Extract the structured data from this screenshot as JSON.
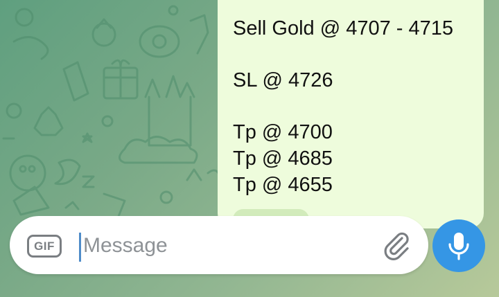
{
  "message": {
    "lines": [
      "Sell Gold @ 4707 - 4715",
      "SL @ 4726",
      "Tp @ 4700",
      "Tp @ 4685",
      "Tp @ 4655"
    ]
  },
  "composer": {
    "gif_label": "GIF",
    "placeholder": "Message"
  },
  "colors": {
    "bubble": "#eefcdc",
    "accent": "#3596e5",
    "wallpaper": "#79a987"
  },
  "icons": {
    "attach": "paperclip-icon",
    "mic": "microphone-icon"
  }
}
